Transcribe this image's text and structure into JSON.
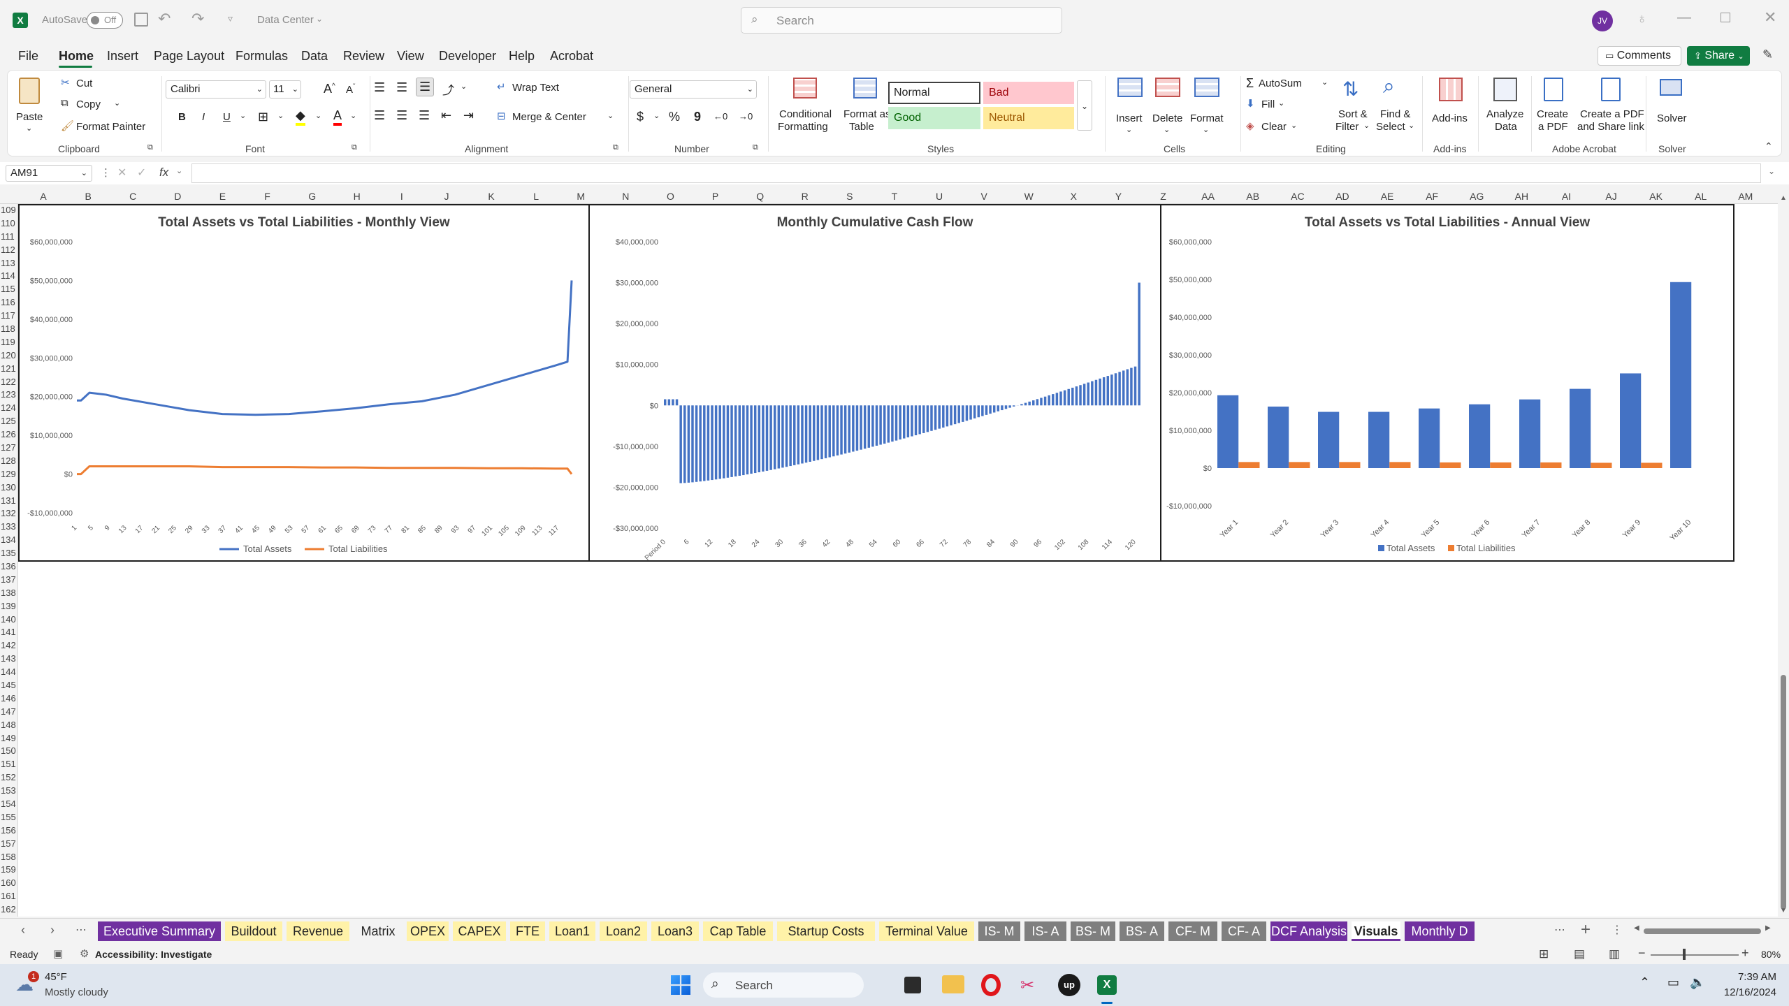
{
  "titlebar": {
    "autosave_label": "AutoSave",
    "autosave_state": "Off",
    "doc_title": "Data Center",
    "search_placeholder": "Search",
    "avatar_initials": "JV"
  },
  "menu": [
    "File",
    "Home",
    "Insert",
    "Page Layout",
    "Formulas",
    "Data",
    "Review",
    "View",
    "Developer",
    "Help",
    "Acrobat"
  ],
  "actions": {
    "comments": "Comments",
    "share": "Share"
  },
  "ribbon": {
    "clipboard": {
      "paste": "Paste",
      "cut": "Cut",
      "copy": "Copy",
      "format_painter": "Format Painter",
      "group": "Clipboard"
    },
    "font": {
      "name": "Calibri",
      "size": "11",
      "group": "Font",
      "bold": "B",
      "italic": "I",
      "underline": "U"
    },
    "alignment": {
      "wrap": "Wrap Text",
      "merge": "Merge & Center",
      "group": "Alignment"
    },
    "number": {
      "format": "General",
      "currency": "$",
      "percent": "%",
      "comma": "9",
      "group": "Number"
    },
    "styles": {
      "cond_fmt_1": "Conditional",
      "cond_fmt_2": "Formatting",
      "format_table_1": "Format as",
      "format_table_2": "Table",
      "normal": "Normal",
      "bad": "Bad",
      "good": "Good",
      "neutral": "Neutral",
      "group": "Styles"
    },
    "cells": {
      "insert": "Insert",
      "delete": "Delete",
      "format": "Format",
      "group": "Cells"
    },
    "editing": {
      "autosum": "AutoSum",
      "fill": "Fill",
      "clear": "Clear",
      "sort_1": "Sort &",
      "sort_2": "Filter",
      "find_1": "Find &",
      "find_2": "Select",
      "group": "Editing"
    },
    "addins": {
      "label": "Add-ins",
      "group": "Add-ins"
    },
    "analyze": {
      "label_1": "Analyze",
      "label_2": "Data"
    },
    "acrobat": {
      "create_1": "Create",
      "create_2": "a PDF",
      "share_1": "Create a PDF",
      "share_2": "and Share link",
      "group": "Adobe Acrobat"
    },
    "solver": {
      "label": "Solver",
      "group": "Solver"
    }
  },
  "formula": {
    "namebox": "AM91",
    "fx": "fx",
    "content": ""
  },
  "columns": [
    "A",
    "B",
    "C",
    "D",
    "E",
    "F",
    "G",
    "H",
    "I",
    "J",
    "K",
    "L",
    "M",
    "N",
    "O",
    "P",
    "Q",
    "R",
    "S",
    "T",
    "U",
    "V",
    "W",
    "X",
    "Y",
    "Z",
    "AA",
    "AB",
    "AC",
    "AD",
    "AE",
    "AF",
    "AG",
    "AH",
    "AI",
    "AJ",
    "AK",
    "AL",
    "AM"
  ],
  "rows": [
    "109",
    "110",
    "111",
    "112",
    "113",
    "114",
    "115",
    "116",
    "117",
    "118",
    "119",
    "120",
    "121",
    "122",
    "123",
    "124",
    "125",
    "126",
    "127",
    "128",
    "129",
    "130",
    "131",
    "132",
    "133",
    "134",
    "135",
    "136",
    "137",
    "138",
    "139",
    "140",
    "141",
    "142",
    "143",
    "144",
    "145",
    "146",
    "147",
    "148",
    "149",
    "150",
    "151",
    "152",
    "153",
    "154",
    "155",
    "156",
    "157",
    "158",
    "159",
    "160",
    "161",
    "162"
  ],
  "chart_data": [
    {
      "type": "line",
      "title": "Total Assets vs Total Liabilities - Monthly View",
      "ylim": [
        -10000000,
        60000000
      ],
      "yticks": [
        "-$10,000,000",
        "$0",
        "$10,000,000",
        "$20,000,000",
        "$30,000,000",
        "$40,000,000",
        "$50,000,000",
        "$60,000,000"
      ],
      "xticks": [
        "1",
        "5",
        "9",
        "13",
        "17",
        "21",
        "25",
        "29",
        "33",
        "37",
        "41",
        "45",
        "49",
        "53",
        "57",
        "61",
        "65",
        "69",
        "73",
        "77",
        "81",
        "85",
        "89",
        "93",
        "97",
        "101",
        "105",
        "109",
        "113",
        "117"
      ],
      "x": [
        1,
        2,
        4,
        8,
        12,
        20,
        28,
        36,
        44,
        52,
        60,
        68,
        76,
        84,
        92,
        100,
        108,
        116,
        119,
        120
      ],
      "series": [
        {
          "name": "Total Assets",
          "color": "#4472c4",
          "values": [
            19000000,
            19000000,
            21000000,
            20500000,
            19500000,
            18000000,
            16500000,
            15500000,
            15300000,
            15500000,
            16200000,
            17000000,
            18000000,
            18800000,
            20500000,
            23000000,
            25500000,
            28000000,
            29000000,
            50000000
          ]
        },
        {
          "name": "Total Liabilities",
          "color": "#ed7d31",
          "values": [
            0,
            0,
            2000000,
            2000000,
            2000000,
            2000000,
            2000000,
            1800000,
            1800000,
            1800000,
            1700000,
            1700000,
            1600000,
            1600000,
            1600000,
            1500000,
            1500000,
            1400000,
            1400000,
            0
          ]
        }
      ],
      "legend": "bottom"
    },
    {
      "type": "bar",
      "title": "Monthly Cumulative Cash Flow",
      "ylim": [
        -30000000,
        40000000
      ],
      "yticks": [
        "-$30,000,000",
        "-$20,000,000",
        "-$10,000,000",
        "$0",
        "$10,000,000",
        "$20,000,000",
        "$30,000,000",
        "$40,000,000"
      ],
      "xticks": [
        "Period 0",
        "6",
        "12",
        "18",
        "24",
        "30",
        "36",
        "42",
        "48",
        "54",
        "60",
        "66",
        "72",
        "78",
        "84",
        "90",
        "96",
        "102",
        "108",
        "114",
        "120"
      ],
      "series": [
        {
          "name": "Cumulative Cash Flow",
          "color": "#4472c4",
          "profile": {
            "start": [
              0,
              1500000
            ],
            "drop": [
              4,
              -19000000
            ],
            "recover_to": [
              120,
              9500000
            ],
            "final": [
              121,
              30000000
            ]
          }
        }
      ]
    },
    {
      "type": "bar",
      "title": "Total Assets vs Total Liabilities - Annual View",
      "ylim": [
        -10000000,
        60000000
      ],
      "yticks": [
        "-$10,000,000",
        "$0",
        "$10,000,000",
        "$20,000,000",
        "$30,000,000",
        "$40,000,000",
        "$50,000,000",
        "$60,000,000"
      ],
      "categories": [
        "Year 1",
        "Year 2",
        "Year 3",
        "Year 4",
        "Year 5",
        "Year 6",
        "Year 7",
        "Year 8",
        "Year 9",
        "Year 10"
      ],
      "series": [
        {
          "name": "Total Assets",
          "color": "#4472c4",
          "values": [
            19300000,
            16300000,
            14900000,
            14900000,
            15800000,
            16900000,
            18200000,
            21000000,
            25100000,
            49300000
          ]
        },
        {
          "name": "Total Liabilities",
          "color": "#ed7d31",
          "values": [
            1600000,
            1600000,
            1600000,
            1600000,
            1500000,
            1500000,
            1500000,
            1400000,
            1400000,
            0
          ]
        }
      ],
      "legend": "bottom"
    }
  ],
  "sheet_tabs": [
    {
      "label": "Executive Summary",
      "bg": "#7030a0",
      "fg": "#ffffff"
    },
    {
      "label": "Buildout",
      "bg": "#fff2a8",
      "fg": "#242424"
    },
    {
      "label": "Revenue",
      "bg": "#fff2a8",
      "fg": "#242424"
    },
    {
      "label": "Matrix",
      "bg": "#f3f3f3",
      "fg": "#242424"
    },
    {
      "label": "OPEX",
      "bg": "#fff2a8",
      "fg": "#242424"
    },
    {
      "label": "CAPEX",
      "bg": "#fff2a8",
      "fg": "#242424"
    },
    {
      "label": "FTE",
      "bg": "#fff2a8",
      "fg": "#242424"
    },
    {
      "label": "Loan1",
      "bg": "#fff2a8",
      "fg": "#242424"
    },
    {
      "label": "Loan2",
      "bg": "#fff2a8",
      "fg": "#242424"
    },
    {
      "label": "Loan3",
      "bg": "#fff2a8",
      "fg": "#242424"
    },
    {
      "label": "Cap Table",
      "bg": "#fff2a8",
      "fg": "#242424"
    },
    {
      "label": "Startup Costs",
      "bg": "#fff2a8",
      "fg": "#242424"
    },
    {
      "label": "Terminal Value",
      "bg": "#fff2a8",
      "fg": "#242424"
    },
    {
      "label": "IS- M",
      "bg": "#7f7f7f",
      "fg": "#ffffff"
    },
    {
      "label": "IS- A",
      "bg": "#7f7f7f",
      "fg": "#ffffff"
    },
    {
      "label": "BS- M",
      "bg": "#7f7f7f",
      "fg": "#ffffff"
    },
    {
      "label": "BS- A",
      "bg": "#7f7f7f",
      "fg": "#ffffff"
    },
    {
      "label": "CF- M",
      "bg": "#7f7f7f",
      "fg": "#ffffff"
    },
    {
      "label": "CF- A",
      "bg": "#7f7f7f",
      "fg": "#ffffff"
    },
    {
      "label": "DCF Analysis",
      "bg": "#7030a0",
      "fg": "#ffffff"
    },
    {
      "label": "Visuals",
      "bg": "#ffffff",
      "fg": "#242424"
    },
    {
      "label": "Monthly D",
      "bg": "#7030a0",
      "fg": "#ffffff"
    }
  ],
  "status": {
    "ready": "Ready",
    "accessibility": "Accessibility: Investigate",
    "zoom": "80%"
  },
  "taskbar": {
    "temp": "45°F",
    "weather": "Mostly cloudy",
    "badge": "1",
    "search": "Search",
    "time": "7:39 AM",
    "date": "12/16/2024"
  }
}
